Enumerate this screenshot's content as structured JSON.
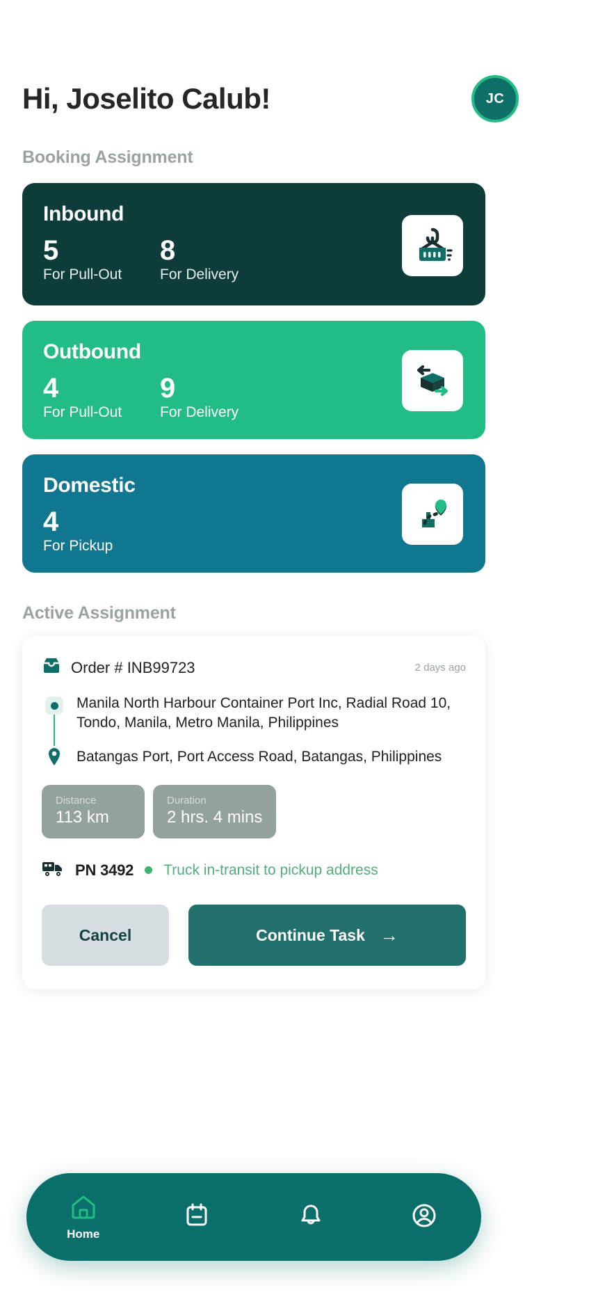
{
  "header": {
    "greeting": "Hi, Joselito Calub!",
    "avatar_initials": "JC"
  },
  "booking": {
    "section_title": "Booking Assignment",
    "cards": [
      {
        "title": "Inbound",
        "color": "#0E3C38",
        "icon": "container-crane-icon",
        "stats": [
          {
            "value": "5",
            "label": "For Pull-Out"
          },
          {
            "value": "8",
            "label": "For Delivery"
          }
        ]
      },
      {
        "title": "Outbound",
        "color": "#22BC85",
        "icon": "box-transfer-icon",
        "stats": [
          {
            "value": "4",
            "label": "For Pull-Out"
          },
          {
            "value": "9",
            "label": "For Delivery"
          }
        ]
      },
      {
        "title": "Domestic",
        "color": "#11768F",
        "icon": "route-pin-box-icon",
        "stats": [
          {
            "value": "4",
            "label": "For Pickup"
          }
        ]
      }
    ]
  },
  "active": {
    "section_title": "Active Assignment",
    "order_label": "Order # INB99723",
    "time_ago": "2 days ago",
    "pickup_address": "Manila North Harbour Container Port Inc, Radial Road 10, Tondo, Manila, Metro Manila, Philippines",
    "dropoff_address": "Batangas Port, Port Access Road, Batangas, Philippines",
    "chips": [
      {
        "label": "Distance",
        "value": "113 km"
      },
      {
        "label": "Duration",
        "value": "2 hrs. 4 mins"
      }
    ],
    "plate": "PN 3492",
    "status": "Truck in-transit to pickup address",
    "status_color": "#4FAE7C",
    "cancel_label": "Cancel",
    "continue_label": "Continue Task",
    "continue_arrow": "→"
  },
  "nav": {
    "items": [
      {
        "label": "Home",
        "icon": "home-icon",
        "active": true
      },
      {
        "label": "",
        "icon": "calendar-icon",
        "active": false
      },
      {
        "label": "",
        "icon": "bell-icon",
        "active": false
      },
      {
        "label": "",
        "icon": "profile-icon",
        "active": false
      }
    ]
  }
}
